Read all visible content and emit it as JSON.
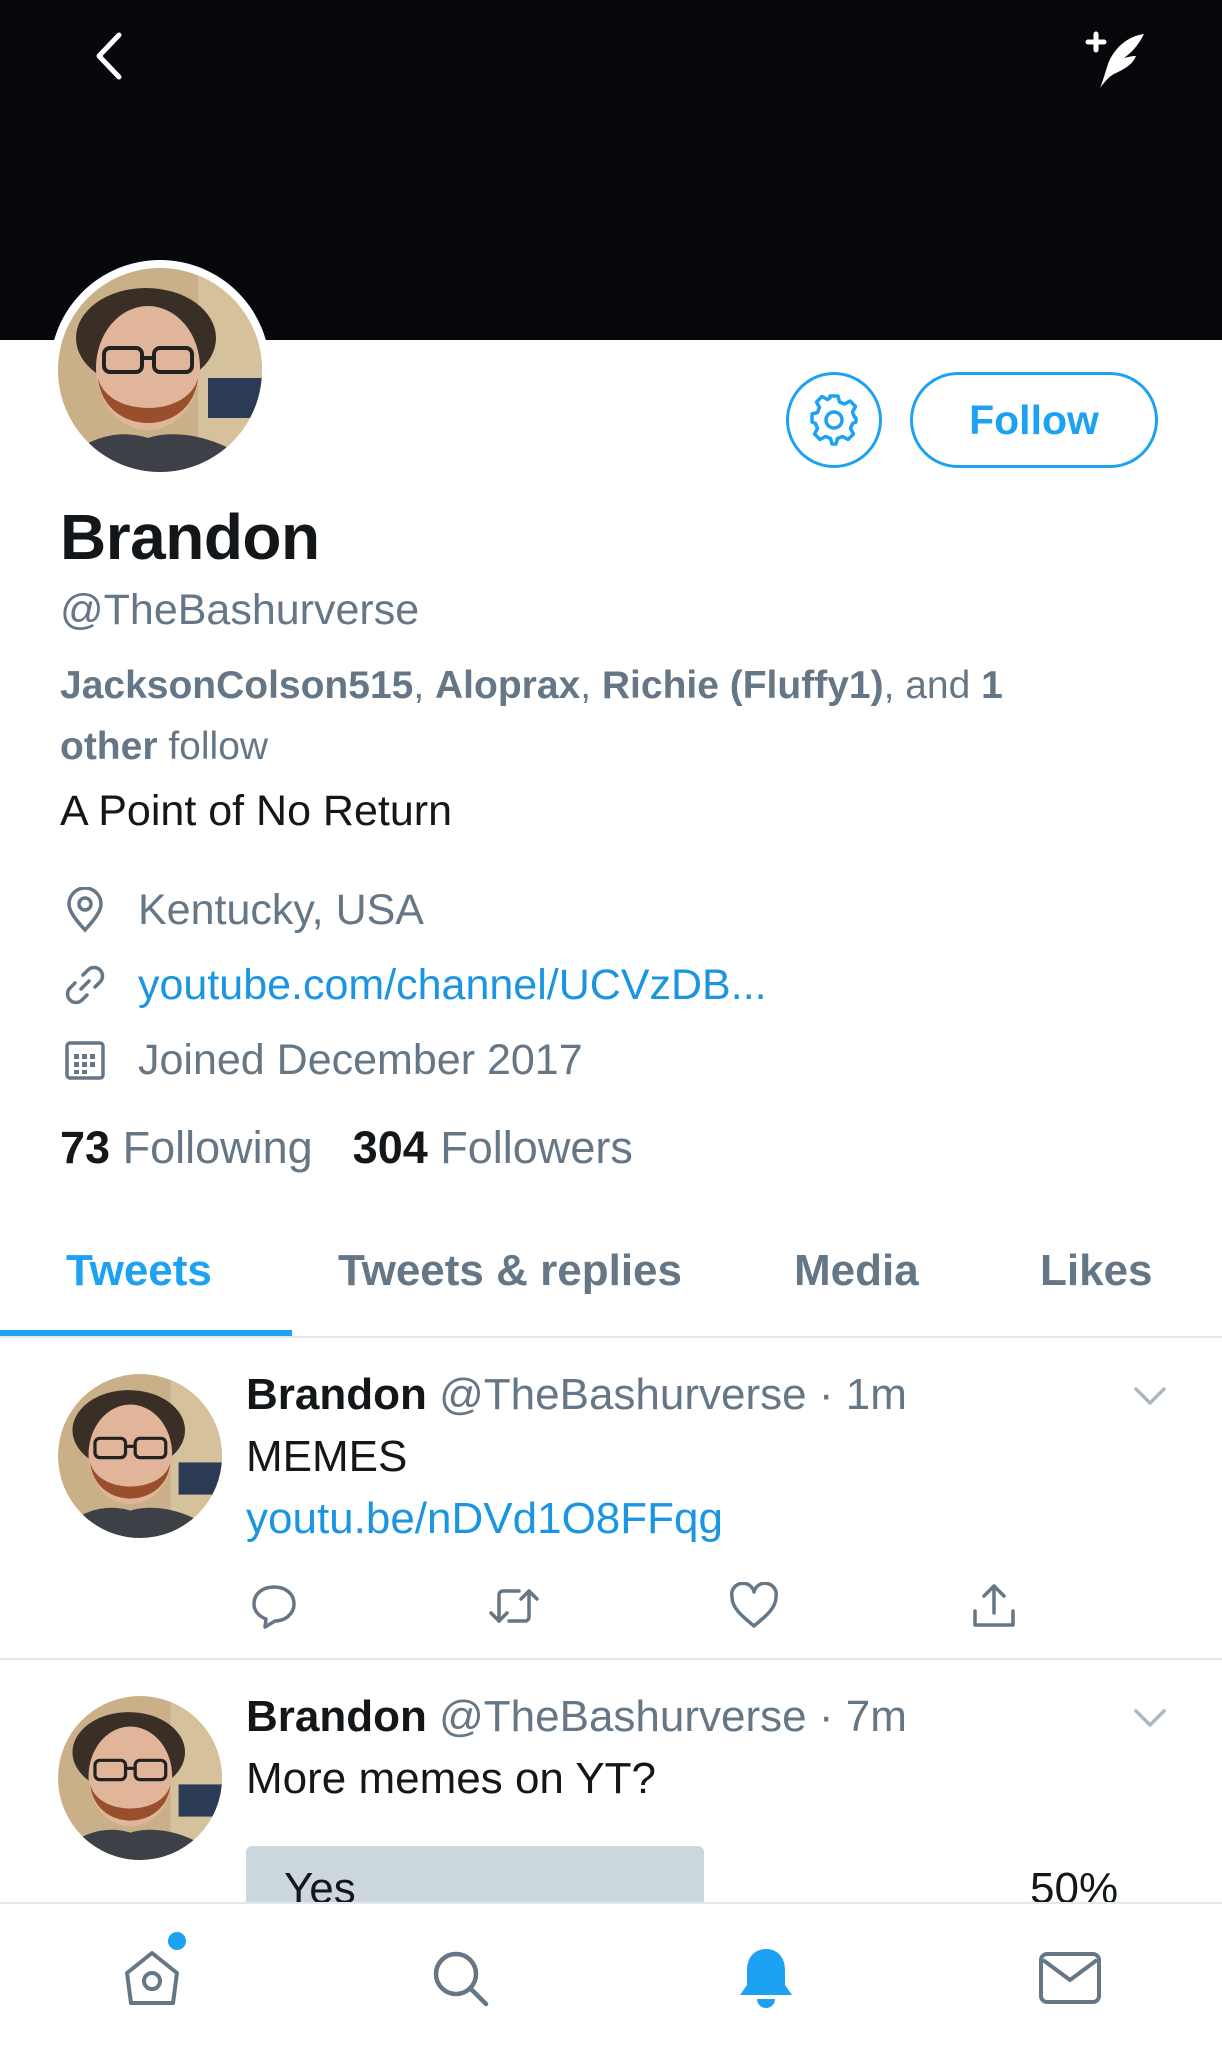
{
  "profile": {
    "name": "Brandon",
    "handle": "@TheBashurverse",
    "follow_label": "Follow",
    "followed_by": {
      "names": [
        "JacksonColson515",
        "Aloprax",
        "Richie (Fluffy1)"
      ],
      "sep": ", ",
      "and": ", and ",
      "other_count": "1",
      "other_word": "other",
      "suffix": " follow"
    },
    "bio": "A Point of No Return",
    "location": "Kentucky, USA",
    "website": "youtube.com/channel/UCVzDB...",
    "joined": "Joined December 2017",
    "following_count": "73",
    "following_label": "Following",
    "followers_count": "304",
    "followers_label": "Followers"
  },
  "tabs": [
    "Tweets",
    "Tweets & replies",
    "Media",
    "Likes"
  ],
  "tweets": [
    {
      "name": "Brandon",
      "handle": "@TheBashurverse",
      "time": "· 1m",
      "text": "MEMES",
      "link": "youtu.be/nDVd1O8FFqg"
    },
    {
      "name": "Brandon",
      "handle": "@TheBashurverse",
      "time": "· 7m",
      "text": "More memes on YT?",
      "poll": {
        "option": "Yes",
        "percent": "50%",
        "fraction": 0.5
      }
    }
  ],
  "icons": {
    "back": "chevron-left-icon",
    "compose": "compose-feather-icon",
    "settings": "gear-icon",
    "location": "location-pin-icon",
    "link": "link-icon",
    "calendar": "calendar-icon",
    "reply": "reply-icon",
    "retweet": "retweet-icon",
    "like": "heart-icon",
    "share": "share-icon",
    "caret": "chevron-down-icon",
    "home": "home-icon",
    "search": "search-icon",
    "notifications": "bell-icon",
    "messages": "mail-icon"
  },
  "colors": {
    "accent": "#1da1f2",
    "link": "#1b95e0",
    "secondary_text": "#657786",
    "banner": "#05070a"
  }
}
